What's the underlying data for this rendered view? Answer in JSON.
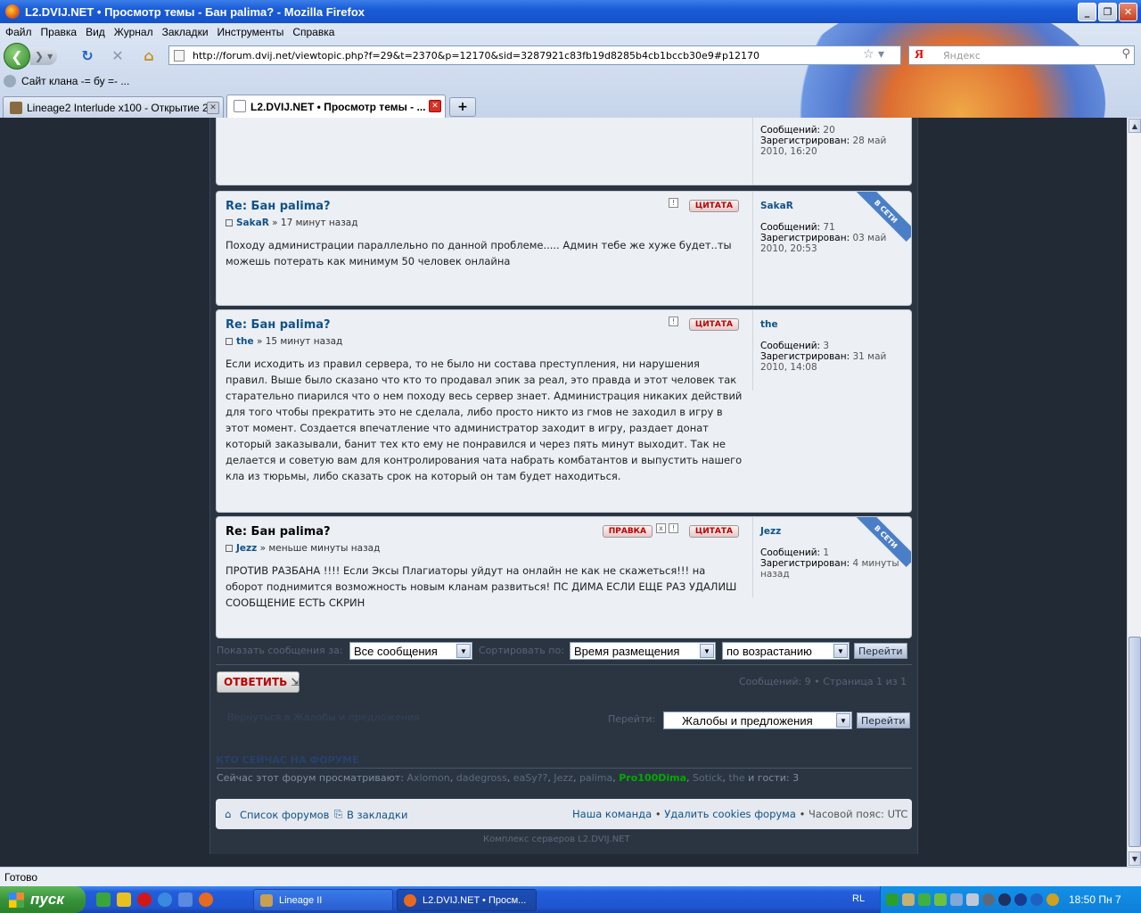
{
  "window": {
    "title": "L2.DVIJ.NET • Просмотр темы - Бан palima? - Mozilla Firefox",
    "min_glyph": "_",
    "max_glyph": "❐",
    "close_glyph": "✕"
  },
  "menu": [
    "Файл",
    "Правка",
    "Вид",
    "Журнал",
    "Закладки",
    "Инструменты",
    "Справка"
  ],
  "nav": {
    "url": "http://forum.dvij.net/viewtopic.php?f=29&t=2370&p=12170&sid=3287921c83fb19d8285b4cb1bccb30e9#p12170",
    "search_placeholder": "Яндекс",
    "search_logo": "Я"
  },
  "bookmarks": {
    "item": "Сайт клана -= бу =- ..."
  },
  "tabs": [
    {
      "label": "Lineage2 Interlude x100 - Открытие 2...",
      "active": false
    },
    {
      "label": "L2.DVIJ.NET • Просмотр темы - ...",
      "active": true
    }
  ],
  "posts": {
    "first_profile": {
      "posts_label": "Сообщений:",
      "posts": "20",
      "reg_label": "Зарегистрирован:",
      "reg": "28 май 2010, 16:20"
    },
    "items": [
      {
        "title": "Re: Бан palima?",
        "author": "SakaR",
        "time": "» 17 минут назад",
        "text": "Походу администрации параллельно по данной проблеме..... Админ тебе же хуже будет..ты можешь потерать как минимум 50 человек онлайна",
        "quote": "ЦИТАТА",
        "username": "SakaR",
        "posts_label": "Сообщений:",
        "posts": "71",
        "reg_label": "Зарегистрирован:",
        "reg": "03 май 2010, 20:53",
        "online_label": "В СЕТИ"
      },
      {
        "title": "Re: Бан palima?",
        "author": "the",
        "time": "» 15 минут назад",
        "text": "Если исходить из правил сервера, то не было ни состава преступления, ни нарушения правил. Выше было сказано что кто то продавал эпик за реал, это правда и этот человек так старательно пиарился что о нем походу весь сервер знает. Администрация никаких действий для того чтобы прекратить это не сделала, либо просто никто из гмов не заходил в игру в этот момент. Создается впечатление что администратор заходит в игру, раздает донат который заказывали, банит тех кто ему не понравился и через пять минут выходит. Так не делается и советую вам для контролирования чата набрать комбатантов и выпустить нашего кла из тюрьмы, либо сказать срок на который он там будет находиться.",
        "quote": "ЦИТАТА",
        "username": "the",
        "posts_label": "Сообщений:",
        "posts": "3",
        "reg_label": "Зарегистрирован:",
        "reg": "31 май 2010, 14:08"
      },
      {
        "title": "Re: Бан palima?",
        "author": "Jezz",
        "time": "» меньше минуты назад",
        "text": "ПРОТИВ РАЗБАНА !!!! Если Эксы Плагиаторы уйдут на онлайн не как не скажеться!!! на оборот поднимится возможность новым кланам развиться! ПС ДИМА ЕСЛИ ЕЩЕ РАЗ УДАЛИШ СООБЩЕНИЕ ЕСТЬ СКРИН",
        "quote": "ЦИТАТА",
        "edit": "ПРАВКА",
        "username": "Jezz",
        "posts_label": "Сообщений:",
        "posts": "1",
        "reg_label": "Зарегистрирован:",
        "reg": "4 минуты назад",
        "online_label": "В СЕТИ"
      }
    ]
  },
  "sortbar": {
    "show_label": "Показать сообщения за:",
    "show_value": "Все сообщения",
    "sort_label": "Сортировать по:",
    "sort_value": "Время размещения",
    "order_value": "по возрастанию",
    "go": "Перейти"
  },
  "reply": {
    "label": "ОТВЕТИТЬ",
    "pagination": "Сообщений: 9 • Страница 1 из 1"
  },
  "jump": {
    "back_link": "Вернуться в Жалобы и предложения",
    "label": "Перейти:",
    "value": "Жалобы и предложения",
    "go": "Перейти"
  },
  "online": {
    "heading": "КТО СЕЙЧАС НА ФОРУМЕ",
    "prefix": "Сейчас этот форум просматривают:",
    "users": [
      {
        "name": "Axlomon",
        "color": "#5a6c82"
      },
      {
        "name": "dadegross",
        "color": "#5a6c82"
      },
      {
        "name": "eaSy??",
        "color": "#5a6c82"
      },
      {
        "name": "Jezz",
        "color": "#5a6c82"
      },
      {
        "name": "palima",
        "color": "#5a6c82"
      },
      {
        "name": "Pro100Dima",
        "color": "#00aa00"
      },
      {
        "name": "Sotick",
        "color": "#5a6c82"
      },
      {
        "name": "the",
        "color": "#5a6c82"
      }
    ],
    "sep": ",",
    "suffix": "и гости: 3"
  },
  "footer": {
    "forum_list": "Список форумов",
    "bookmarks": "В закладки",
    "team": "Наша команда",
    "sep": "•",
    "cookies": "Удалить cookies форума",
    "timezone": "Часовой пояс: UTC",
    "copyright": "Комплекс серверов L2.DVIJ.NET"
  },
  "status": "Готово",
  "taskbar": {
    "start": "пуск",
    "items": [
      "Lineage II",
      "L2.DVIJ.NET • Просм..."
    ],
    "lang": "RL",
    "clock": "18:50 Пн 7"
  },
  "colors": {
    "link": "#105289",
    "quote_red": "#b00000",
    "online_badge": "#4a7fc8",
    "forum_bg": "#2b3542",
    "page_bg": "#222a35"
  }
}
